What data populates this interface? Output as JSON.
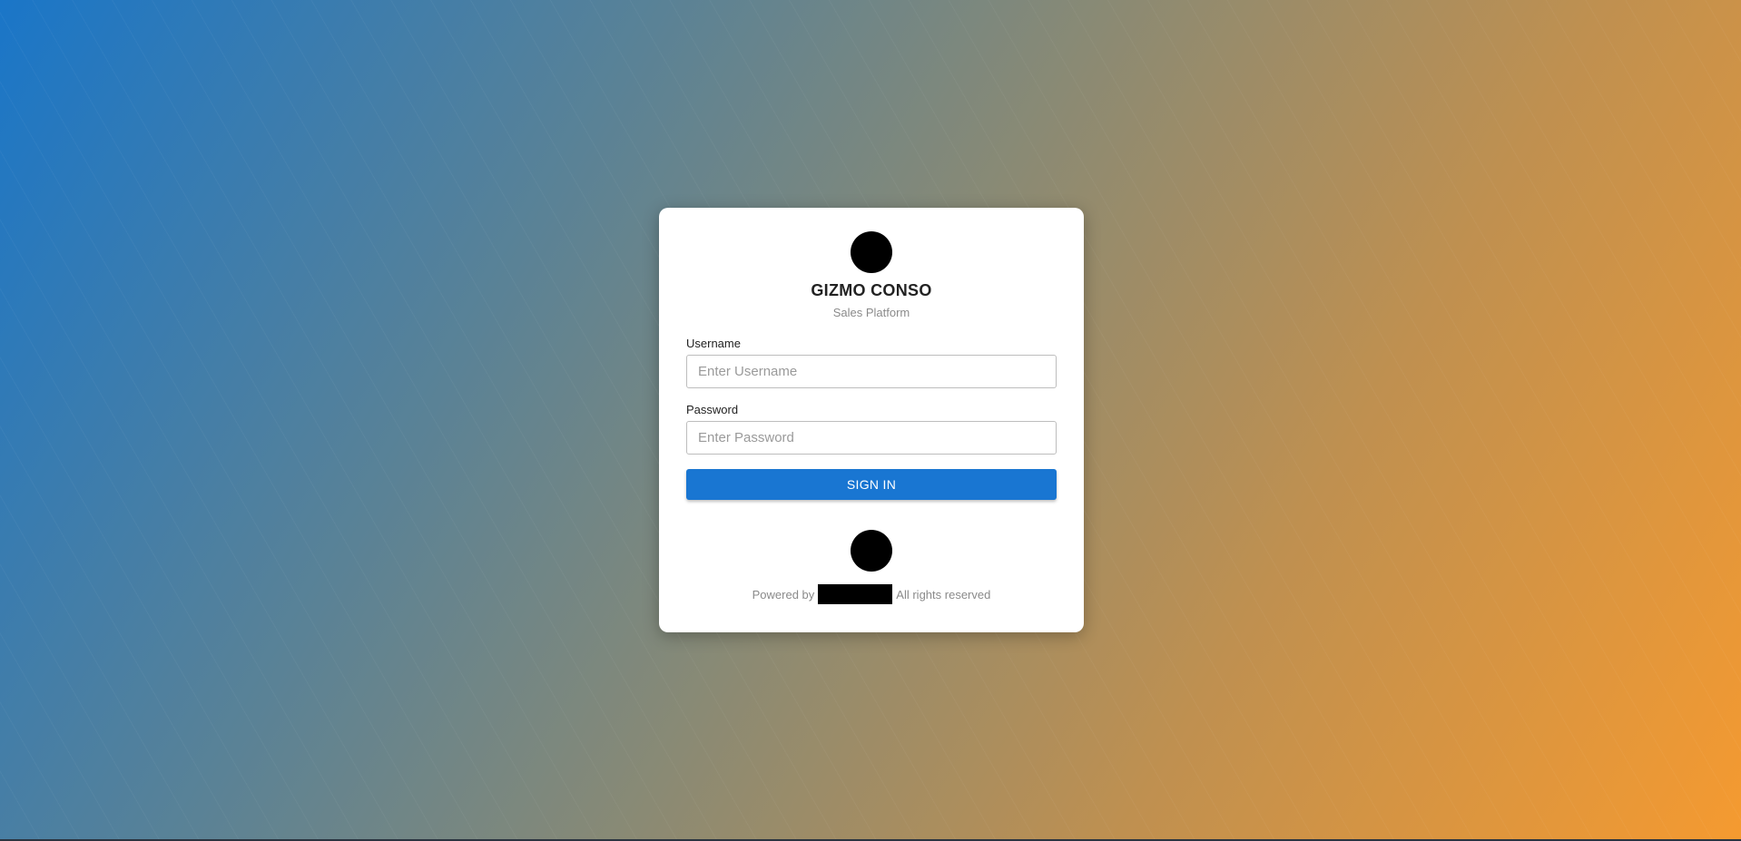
{
  "brand": {
    "title": "GIZMO CONSO",
    "subtitle": "Sales Platform"
  },
  "form": {
    "username_label": "Username",
    "username_placeholder": "Enter Username",
    "password_label": "Password",
    "password_placeholder": "Enter Password",
    "submit_label": "SIGN IN"
  },
  "footer": {
    "powered_by": "Powered by",
    "rights": "All rights reserved"
  },
  "colors": {
    "primary": "#1976d2",
    "gradient_start": "#1a76c8",
    "gradient_end": "#f59a30"
  },
  "icons": {
    "top_logo": "company-logo-icon",
    "bottom_logo": "vendor-logo-icon"
  }
}
